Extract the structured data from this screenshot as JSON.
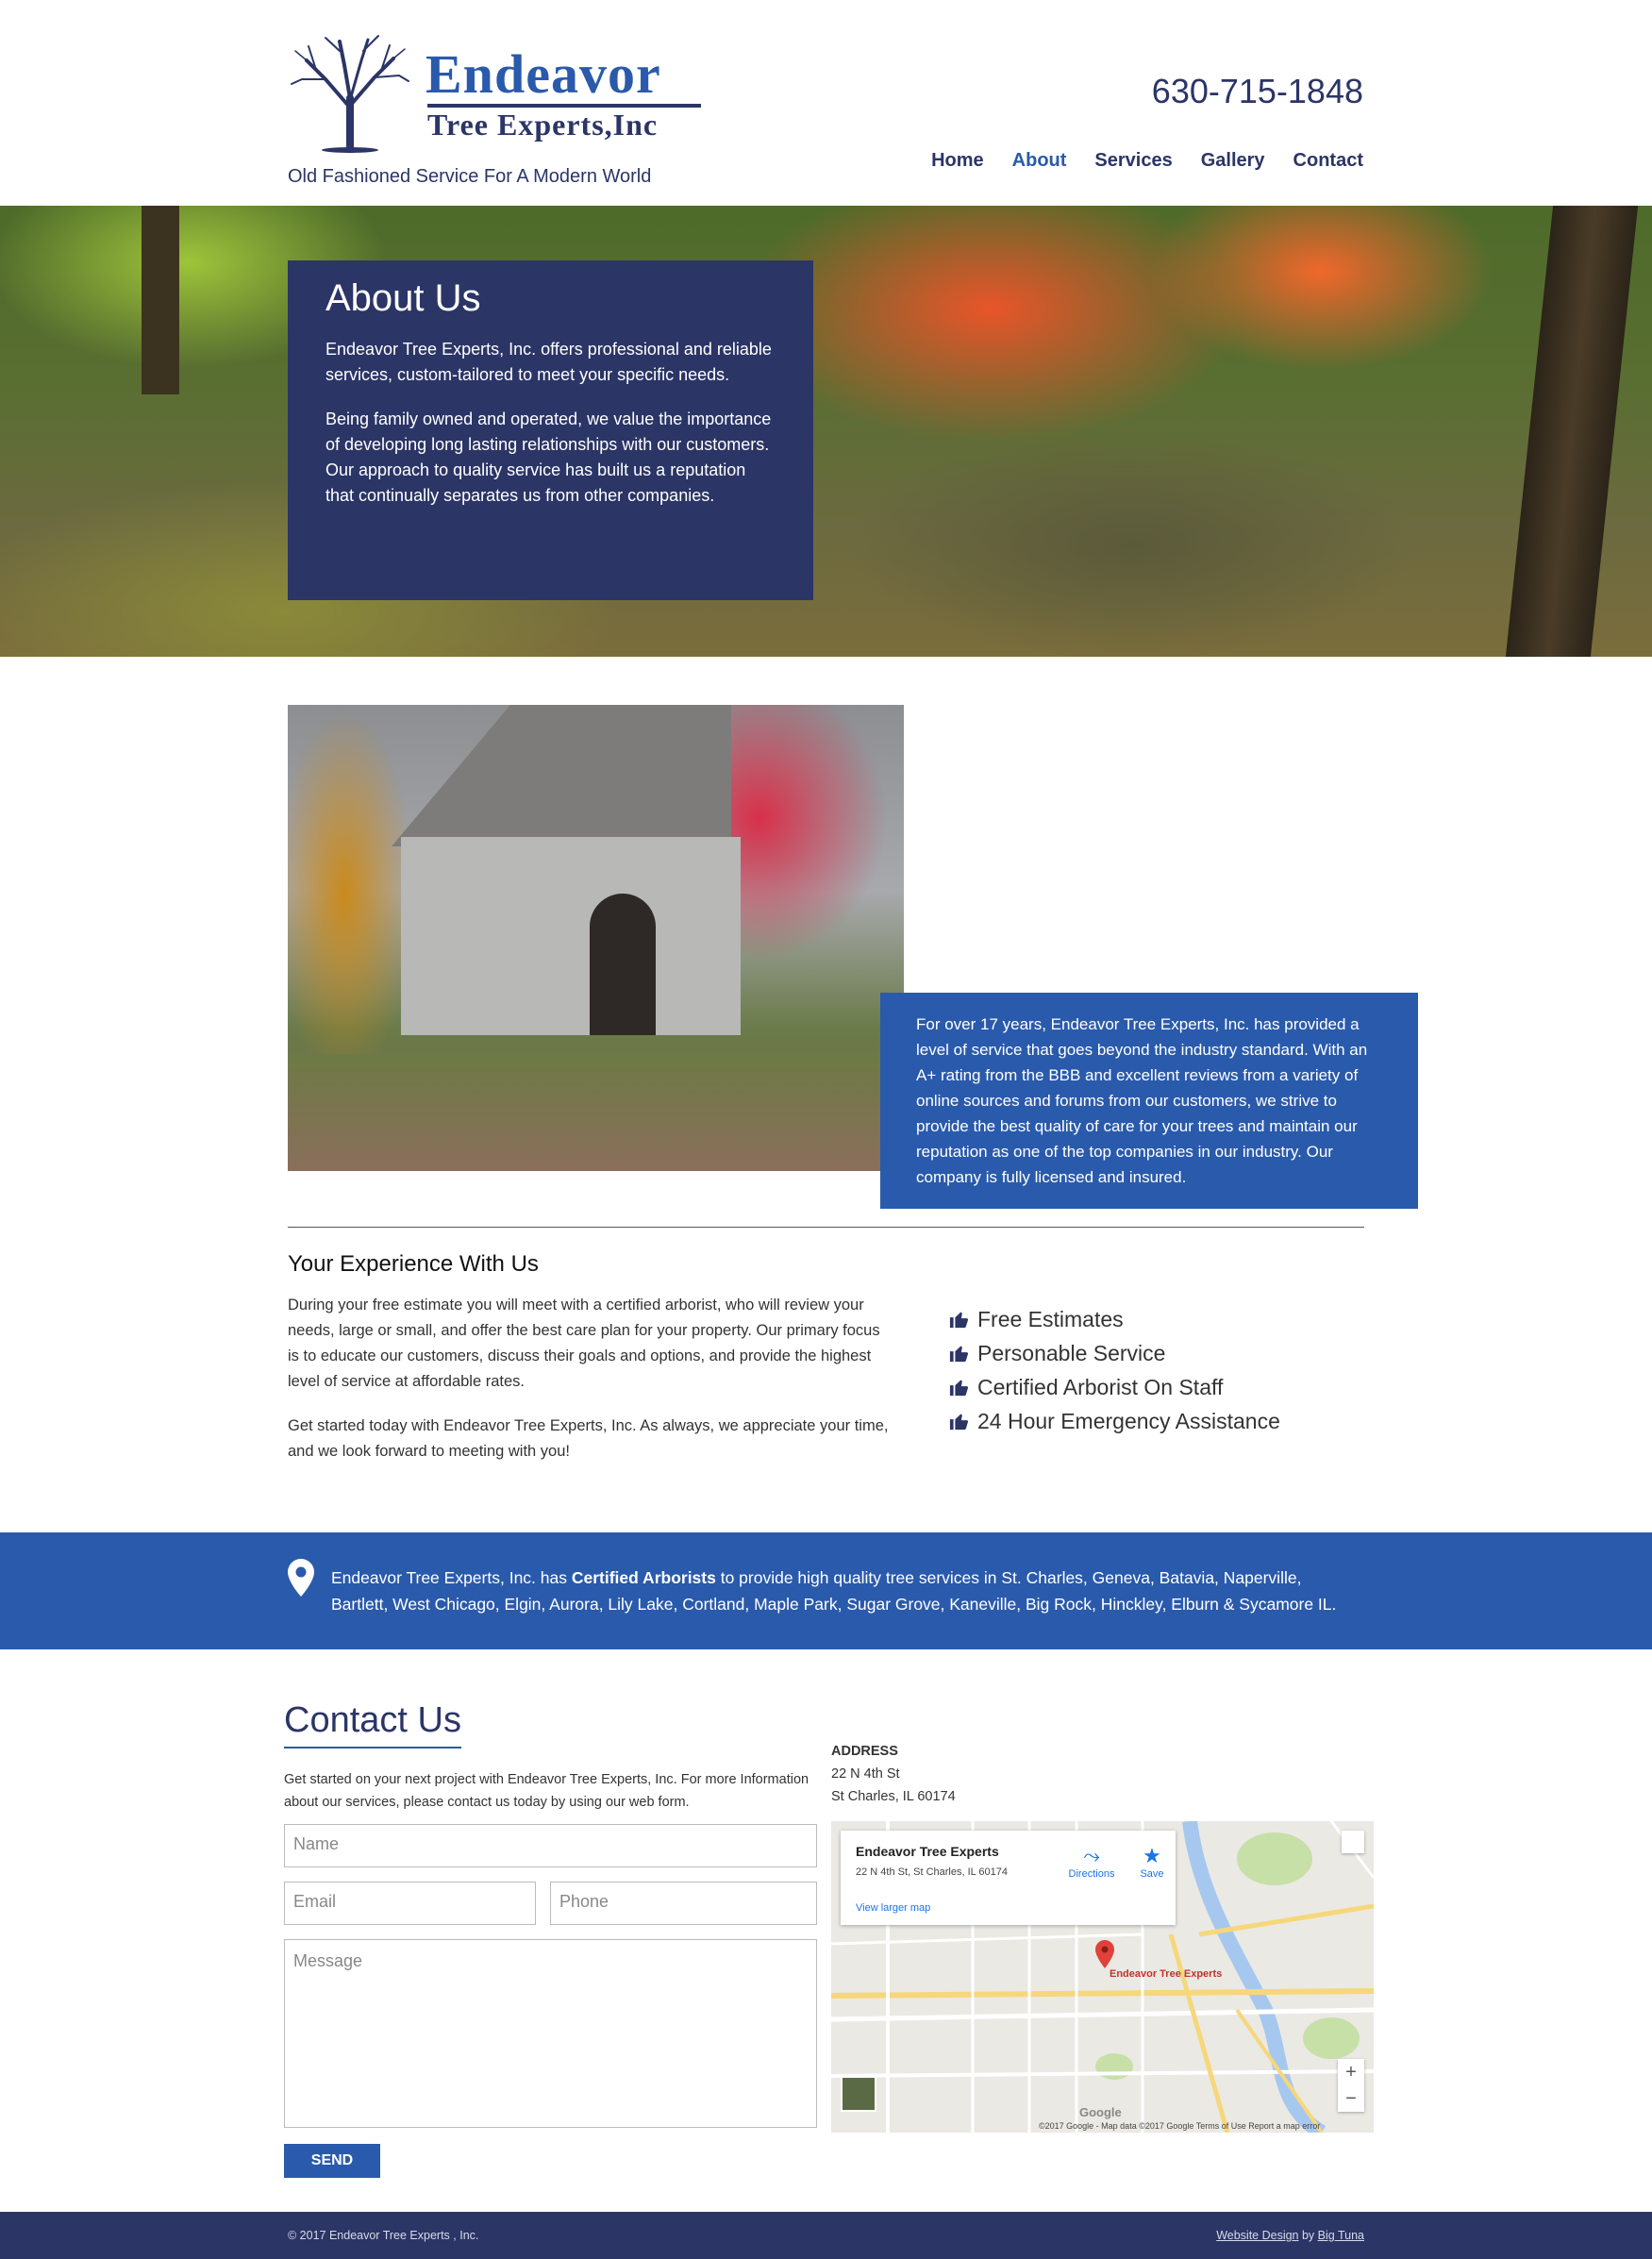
{
  "header": {
    "logo_word1": "Endeavor",
    "logo_word2": "Tree Experts,Inc",
    "tagline": "Old Fashioned Service For A Modern World",
    "phone": "630-715-1848",
    "nav": [
      "Home",
      "About",
      "Services",
      "Gallery",
      "Contact"
    ],
    "active_nav": "About"
  },
  "hero": {
    "title": "About Us",
    "p1": "Endeavor Tree Experts, Inc. offers professional and reliable services, custom-tailored to meet your specific needs.",
    "p2": "Being family owned and operated, we value the importance of developing long lasting relationships with our customers. Our approach to quality service has built us a reputation that continually separates us from other companies."
  },
  "intro": {
    "text": "For over 17 years, Endeavor Tree Experts, Inc. has provided a level of service that goes beyond the industry standard. With an A+ rating from the BBB and excellent reviews from a variety of online sources and forums from our customers, we strive to provide the best quality of care for your trees and maintain our reputation as one of the top companies in our industry. Our company is fully licensed and insured."
  },
  "experience": {
    "title": "Your Experience With Us",
    "p1": "During your free estimate you will meet with a certified arborist, who will review your needs, large or small, and offer the best care plan for your property. Our primary focus is to educate our customers, discuss their goals and options, and provide the highest level of service at affordable rates.",
    "p2": "Get started today with Endeavor Tree Experts, Inc. As always, we appreciate your time, and we look forward to meeting with you!",
    "features": [
      "Free Estimates",
      "Personable Service",
      "Certified Arborist On Staff",
      "24 Hour Emergency Assistance"
    ]
  },
  "banner": {
    "prefix": "Endeavor Tree Experts, Inc. has ",
    "bold": "Certified Arborists",
    "suffix": " to provide high quality tree services in St. Charles, Geneva, Batavia, Naperville, Bartlett, West Chicago, Elgin, Aurora, Lily Lake, Cortland, Maple Park, Sugar Grove, Kaneville, Big Rock, Hinckley, Elburn & Sycamore IL."
  },
  "contact": {
    "title": "Contact Us",
    "intro": "Get started on your next project with Endeavor Tree Experts, Inc. For more Information about our services, please contact us today by using our web form.",
    "placeholders": {
      "name": "Name",
      "email": "Email",
      "phone": "Phone",
      "message": "Message"
    },
    "send_label": "SEND",
    "address_label": "ADDRESS",
    "address_line1": "22 N 4th St",
    "address_line2": "St Charles, IL 60174"
  },
  "map": {
    "business": "Endeavor Tree Experts",
    "business_address": "22 N 4th St, St Charles, IL 60174",
    "directions": "Directions",
    "save": "Save",
    "larger_map": "View larger map",
    "pin_label": "Endeavor Tree Experts",
    "google": "Google",
    "footer": "©2017 Google - Map data ©2017 Google    Terms of Use    Report a map error",
    "zoom_in": "+",
    "zoom_out": "−"
  },
  "footer": {
    "copyright": "© 2017 Endeavor Tree Experts , Inc.",
    "credit_link1": "Website Design",
    "credit_by": " by ",
    "credit_link2": "Big Tuna"
  },
  "colors": {
    "navy": "#2b3566",
    "blue": "#2a5aab"
  }
}
